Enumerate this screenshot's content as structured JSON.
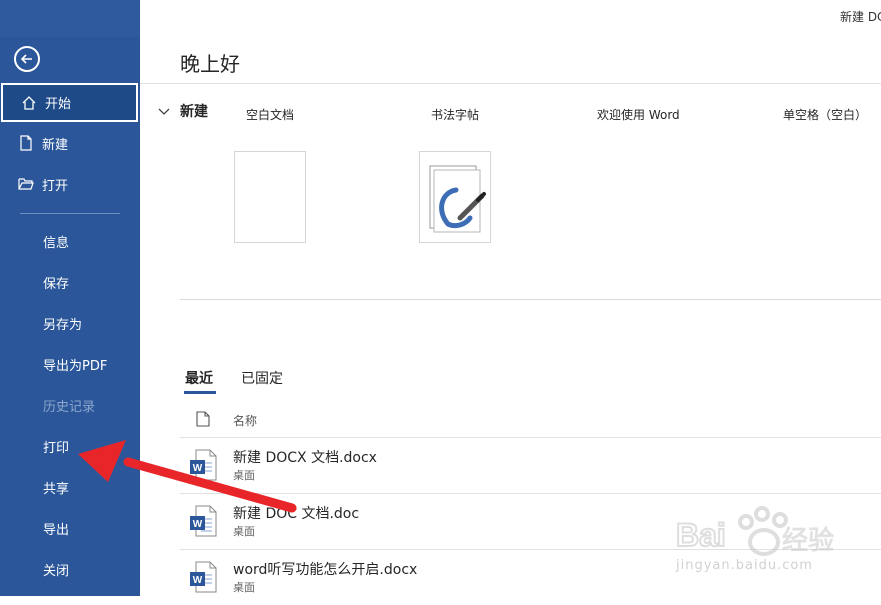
{
  "window": {
    "title_partial": "新建 DC"
  },
  "sidebar": {
    "items": [
      {
        "label": "开始",
        "icon": "home-icon"
      },
      {
        "label": "新建",
        "icon": "new-doc-icon"
      },
      {
        "label": "打开",
        "icon": "folder-open-icon"
      },
      {
        "label": "信息"
      },
      {
        "label": "保存"
      },
      {
        "label": "另存为"
      },
      {
        "label": "导出为PDF"
      },
      {
        "label": "历史记录"
      },
      {
        "label": "打印"
      },
      {
        "label": "共享"
      },
      {
        "label": "导出"
      },
      {
        "label": "关闭"
      }
    ]
  },
  "main": {
    "greeting": "晚上好",
    "new_section": {
      "title": "新建",
      "templates": [
        {
          "label": "空白文档"
        },
        {
          "label": "书法字帖"
        },
        {
          "label": "欢迎使用 Word"
        },
        {
          "label": "单空格（空白）"
        }
      ]
    },
    "tabs": [
      {
        "label": "最近"
      },
      {
        "label": "已固定"
      }
    ],
    "column_name": "名称",
    "files": [
      {
        "name": "新建 DOCX 文档.docx",
        "location": "桌面"
      },
      {
        "name": "新建 DOC 文档.doc",
        "location": "桌面"
      },
      {
        "name": "word听写功能怎么开启.docx",
        "location": "桌面"
      }
    ]
  },
  "watermark": {
    "brand": "Bai经验",
    "url": "jingyan.baidu.com"
  },
  "colors": {
    "sidebar": "#2b579a",
    "arrow": "#e8262a",
    "accent": "#2b579a"
  }
}
